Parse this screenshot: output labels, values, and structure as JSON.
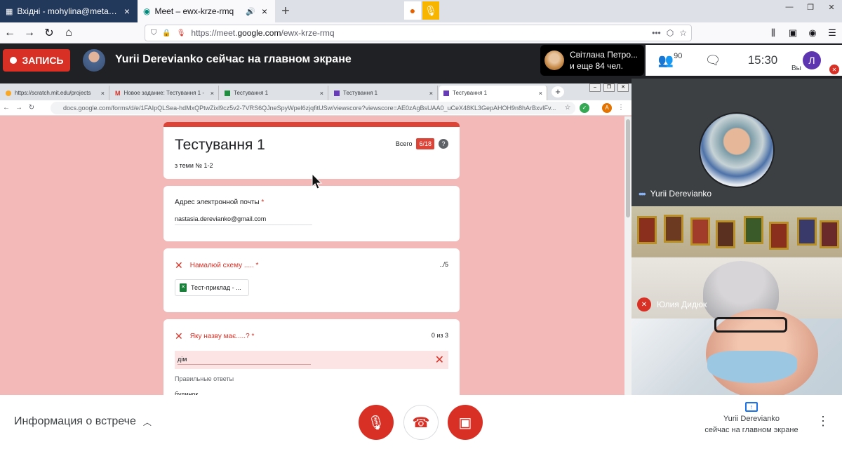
{
  "firefox": {
    "tabs": [
      {
        "title": "Вхідні - mohylina@meta.ua. Ме",
        "icon": "mail-grid-icon"
      },
      {
        "title": "Meet – ewx-krze-rmq",
        "icon": "meet-icon"
      }
    ],
    "url_prefix": "https://meet.",
    "url_domain": "google.com",
    "url_suffix": "/ewx-krze-rmq"
  },
  "meet": {
    "record_label": "ЗАПИСЬ",
    "presenter_title": "Yurii Derevianko сейчас на главном экране",
    "speaker_name": "Світлана Петро...",
    "speaker_more": "и еще 84 чел.",
    "people_count": "90",
    "clock": "15:30",
    "self_initial": "Л",
    "self_label": "Вы",
    "participants": [
      {
        "name": "Yurii Derevianko"
      },
      {
        "name": "Юлия Дидюк"
      }
    ],
    "meeting_info": "Информация о встрече",
    "presenting_name": "Yurii Derevianko",
    "presenting_status": "сейчас на главном экране"
  },
  "shared": {
    "chrome_tabs": [
      {
        "title": "https://scratch.mit.edu/projects"
      },
      {
        "title": "Новое задание: Тестування 1 -"
      },
      {
        "title": "Тестування 1"
      },
      {
        "title": "Тестування 1"
      },
      {
        "title": "Тестування 1"
      }
    ],
    "url": "docs.google.com/forms/d/e/1FAIpQLSea-hdMxQPtwZixl9cz5v2-7VRS6QJneSpyWpel6zjqfitUSw/viewscore?viewscore=AE0zAgBsUAA0_uCeX48KL3GepAHOH9n8hArBxvIFv...",
    "form": {
      "title": "Тестування 1",
      "subtitle": "з теми № 1-2",
      "score_label": "Всего",
      "score": "6/18",
      "email_label": "Адрес электронной почты",
      "email_value": "nastasia.derevianko@gmail.com",
      "q1_label": "Намалюй схему .....",
      "q1_points": "../5",
      "q1_file": "Тест-приклад - ...",
      "q2_label": "Яку назву має.....?",
      "q2_points": "0 из 3",
      "q2_answer": "дім",
      "correct_label": "Правильные ответы",
      "correct_value": "будинок"
    }
  }
}
